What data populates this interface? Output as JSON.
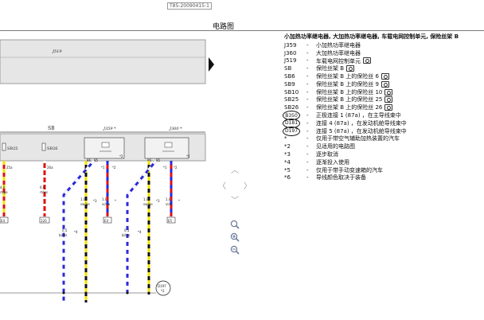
{
  "header": {
    "doc_id": "T85-20090415-1",
    "title": "电路图"
  },
  "diagram": {
    "top_module_label": "J519",
    "fuse_box_label": "SB",
    "relay1_label": "J359 *",
    "relay2_label": "J360 *",
    "fuses": [
      {
        "label": "SB25",
        "pin": "25a",
        "wire_size": "4.0",
        "wire_color": "rt/ge",
        "target": "E4"
      },
      {
        "label": "SB26",
        "pin": "26a",
        "wire_size": "6.0",
        "wire_color": "rt/ws",
        "target": "120"
      }
    ],
    "relay_pins": [
      "86",
      "85",
      "*1",
      "*2",
      "86",
      "85",
      "*1",
      "*2"
    ],
    "relay_wires": [
      {
        "size": "1.0",
        "color": "sw/ge",
        "note": "*3",
        "target": ""
      },
      {
        "size": "1.0",
        "color": "vi/sw",
        "note": "*",
        "target": "E4"
      },
      {
        "size": "1.0",
        "color": "sw/ge",
        "note": "*3",
        "target": ""
      },
      {
        "size": "1.0",
        "color": "vi/rt",
        "note": "*",
        "target": "E5"
      }
    ],
    "ground_wires": [
      {
        "size": "0.5",
        "color": "bl/ws",
        "note": "*4"
      },
      {
        "size": "0.5",
        "color": "bl/ws",
        "note": "*4"
      }
    ],
    "connector_label": "D197",
    "connector_sub": "*2"
  },
  "legend": {
    "heading": "小加热功率继电器, 大加热功率继电器, 车载电网控制单元, 保险丝架 B",
    "rows": [
      {
        "code": "J359",
        "desc": "小加热功率继电器",
        "camera": false,
        "circled": false
      },
      {
        "code": "J360",
        "desc": "大加热功率继电器",
        "camera": false,
        "circled": false
      },
      {
        "code": "J519",
        "desc": "车载电网控制单元",
        "camera": true,
        "circled": false
      },
      {
        "code": "SB",
        "desc": "保险丝架 B",
        "camera": true,
        "circled": false
      },
      {
        "code": "SB6",
        "desc": "保险丝架 B 上的保险丝 6",
        "camera": true,
        "circled": false
      },
      {
        "code": "SB9",
        "desc": "保险丝架 B 上的保险丝 9",
        "camera": true,
        "circled": false
      },
      {
        "code": "SB10",
        "desc": "保险丝架 B 上的保险丝 10",
        "camera": true,
        "circled": false
      },
      {
        "code": "SB25",
        "desc": "保险丝架 B 上的保险丝 25",
        "camera": true,
        "circled": false
      },
      {
        "code": "SB26",
        "desc": "保险丝架 B 上的保险丝 26",
        "camera": true,
        "circled": false
      },
      {
        "code": "B350",
        "desc": "正极连接 1 (87a) ，在主导线束中",
        "camera": false,
        "circled": true
      },
      {
        "code": "D181",
        "desc": "连接 4 (87a) ，在发动机舱导线束中",
        "camera": false,
        "circled": true
      },
      {
        "code": "D197",
        "desc": "连接 5 (87a) ，在发动机舱导线束中",
        "camera": false,
        "circled": true
      },
      {
        "code": "*",
        "desc": "仅用于带空气辅助加热装置的汽车",
        "camera": false,
        "circled": false
      },
      {
        "code": "*2",
        "desc": "见适用的电路图",
        "camera": false,
        "circled": false
      },
      {
        "code": "*3",
        "desc": "逐步取消",
        "camera": false,
        "circled": false
      },
      {
        "code": "*4",
        "desc": "逐渐投入使用",
        "camera": false,
        "circled": false
      },
      {
        "code": "*5",
        "desc": "仅用于带手动变速箱的汽车",
        "camera": false,
        "circled": false
      },
      {
        "code": "*6",
        "desc": "导线颜色取决于装备",
        "camera": false,
        "circled": false
      }
    ]
  },
  "nav": {
    "up_icon": "chevron-up-icon",
    "down_icon": "chevron-down-icon",
    "left_icon": "chevron-left-icon",
    "right_icon": "chevron-right-icon",
    "zoom_fit_icon": "zoom-fit-icon",
    "zoom_in_icon": "zoom-in-icon",
    "zoom_out_icon": "zoom-out-icon"
  }
}
